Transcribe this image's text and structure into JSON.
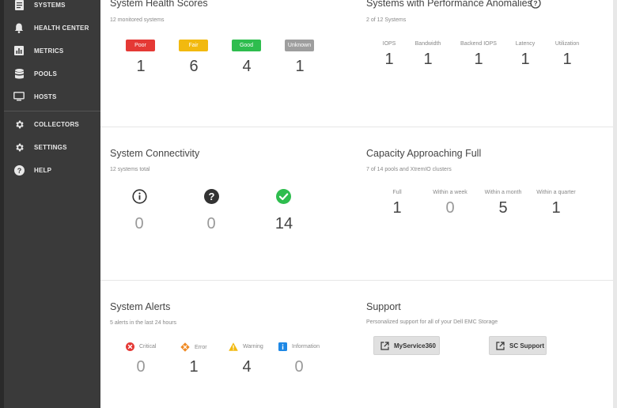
{
  "sidebar": {
    "items": [
      {
        "label": "SYSTEMS",
        "icon": "document-icon"
      },
      {
        "label": "HEALTH CENTER",
        "icon": "bell-icon"
      },
      {
        "label": "METRICS",
        "icon": "bar-chart-icon"
      },
      {
        "label": "POOLS",
        "icon": "database-icon"
      },
      {
        "label": "HOSTS",
        "icon": "monitor-icon"
      },
      {
        "label": "COLLECTORS",
        "icon": "gear-icon"
      },
      {
        "label": "SETTINGS",
        "icon": "gear-icon"
      },
      {
        "label": "HELP",
        "icon": "help-icon"
      }
    ]
  },
  "health": {
    "title": "System Health Scores",
    "subtitle": "12 monitored systems",
    "scores": [
      {
        "label": "Poor",
        "value": "1",
        "color": "#e53935"
      },
      {
        "label": "Fair",
        "value": "6",
        "color": "#f2b90f"
      },
      {
        "label": "Good",
        "value": "4",
        "color": "#2ebd4e"
      },
      {
        "label": "Unknown",
        "value": "1",
        "color": "#9e9e9e"
      }
    ]
  },
  "anomalies": {
    "title": "Systems with Performance Anomalies",
    "subtitle": "2 of 12 Systems",
    "metrics": [
      {
        "label": "IOPS",
        "value": "1"
      },
      {
        "label": "Bandwidth",
        "value": "1"
      },
      {
        "label": "Backend IOPS",
        "value": "1"
      },
      {
        "label": "Latency",
        "value": "1"
      },
      {
        "label": "Utilization",
        "value": "1"
      }
    ]
  },
  "connectivity": {
    "title": "System Connectivity",
    "subtitle": "12 systems total",
    "items": [
      {
        "value": "0",
        "icon": "info-icon"
      },
      {
        "value": "0",
        "icon": "question-icon"
      },
      {
        "value": "14",
        "icon": "check-icon"
      }
    ]
  },
  "capacity": {
    "title": "Capacity Approaching Full",
    "subtitle": "7 of 14 pools and XtremIO clusters",
    "metrics": [
      {
        "label": "Full",
        "value": "1"
      },
      {
        "label": "Within a week",
        "value": "0"
      },
      {
        "label": "Within a month",
        "value": "5"
      },
      {
        "label": "Within a quarter",
        "value": "1"
      }
    ]
  },
  "alerts": {
    "title": "System Alerts",
    "subtitle": "5 alerts in the last 24 hours",
    "items": [
      {
        "label": "Critical",
        "value": "0",
        "color": "#e53935"
      },
      {
        "label": "Error",
        "value": "1",
        "color": "#f08a24"
      },
      {
        "label": "Warning",
        "value": "4",
        "color": "#f2b90f"
      },
      {
        "label": "Information",
        "value": "0",
        "color": "#1e88e5"
      }
    ]
  },
  "support": {
    "title": "Support",
    "subtitle": "Personalized support for all of your Dell EMC Storage",
    "buttons": [
      {
        "label": "MyService360"
      },
      {
        "label": "SC Support"
      }
    ]
  }
}
